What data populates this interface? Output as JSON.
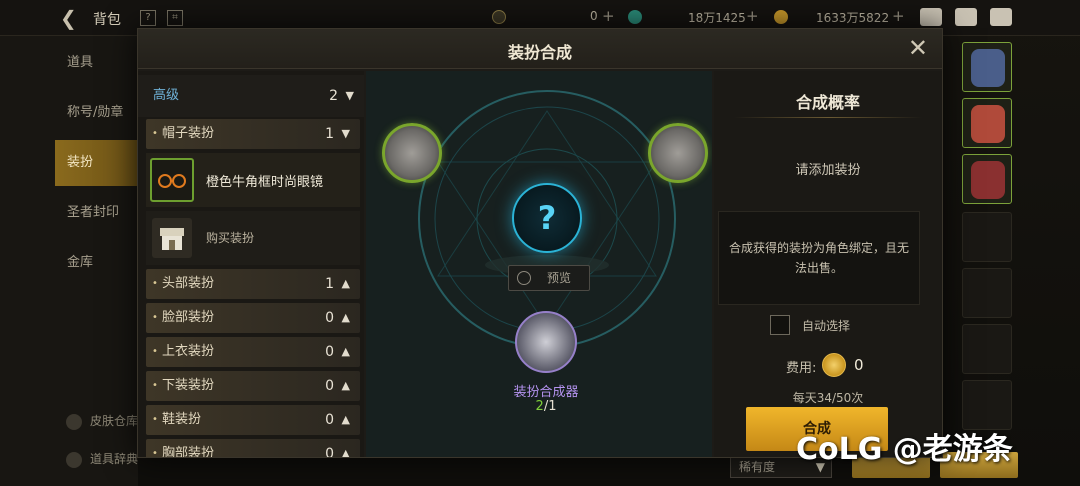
{
  "topbar": {
    "title": "背包",
    "currency1_value": "0",
    "currency2_value": "18万1425",
    "currency3_value": "1633万5822"
  },
  "leftnav": {
    "items": [
      "道具",
      "称号/勋章",
      "装扮",
      "圣者封印",
      "金库"
    ],
    "active_index": 2,
    "bottom_items": [
      "皮肤仓库",
      "道具辞典"
    ]
  },
  "modal": {
    "title": "装扮合成",
    "grade_label": "高级",
    "grade_count": "2",
    "categories": [
      {
        "label": "帽子装扮",
        "count": "1"
      },
      {
        "label": "头部装扮",
        "count": "1"
      },
      {
        "label": "脸部装扮",
        "count": "0"
      },
      {
        "label": "上衣装扮",
        "count": "0"
      },
      {
        "label": "下装装扮",
        "count": "0"
      },
      {
        "label": "鞋装扮",
        "count": "0"
      },
      {
        "label": "胸部装扮",
        "count": "0"
      }
    ],
    "selected_item": "橙色牛角框时尚眼镜",
    "buy_label": "购买装扮",
    "preview_label": "预览",
    "synth_name": "装扮合成器",
    "synth_have": "2",
    "synth_need": "/1",
    "right": {
      "title": "合成概率",
      "hint": "请添加装扮",
      "note": "合成获得的装扮为角色绑定，且无法出售。",
      "auto_select": "自动选择",
      "fee_label": "费用:",
      "fee_value": "0",
      "daily": "每天34/50次",
      "button": "合成"
    }
  },
  "bottom": {
    "rarity_label": "稀有度"
  },
  "watermark": "CoLG @老游条"
}
